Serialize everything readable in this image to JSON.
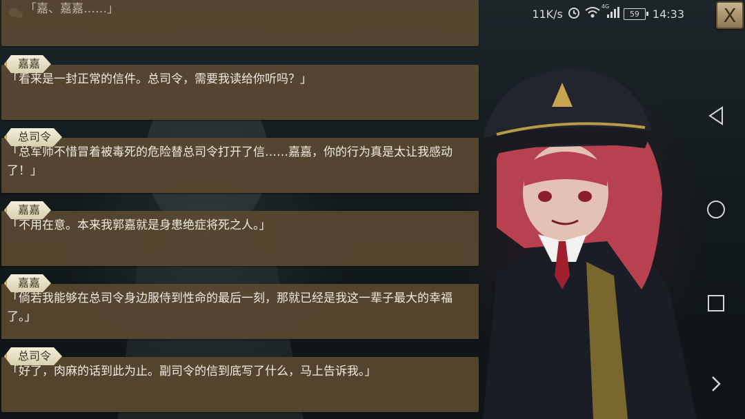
{
  "status_bar": {
    "net_speed": "11K/s",
    "network_badge": "4G",
    "battery": "59",
    "time": "14:33"
  },
  "close_label": "X",
  "dialog": [
    {
      "speaker": "",
      "text": "「嘉、嘉嘉……」"
    },
    {
      "speaker": "嘉嘉",
      "text": "「看来是一封正常的信件。总司令，需要我读给你听吗？」"
    },
    {
      "speaker": "总司令",
      "text": "「总军师不惜冒着被毒死的危险替总司令打开了信……嘉嘉，你的行为真是太让我感动了！」"
    },
    {
      "speaker": "嘉嘉",
      "text": "「不用在意。本来我郭嘉就是身患绝症将死之人。」"
    },
    {
      "speaker": "嘉嘉",
      "text": "「倘若我能够在总司令身边服侍到性命的最后一刻，那就已经是我这一辈子最大的幸福了。」"
    },
    {
      "speaker": "总司令",
      "text": "「好了，肉麻的话到此为止。副司令的信到底写了什么，马上告诉我。」"
    }
  ]
}
